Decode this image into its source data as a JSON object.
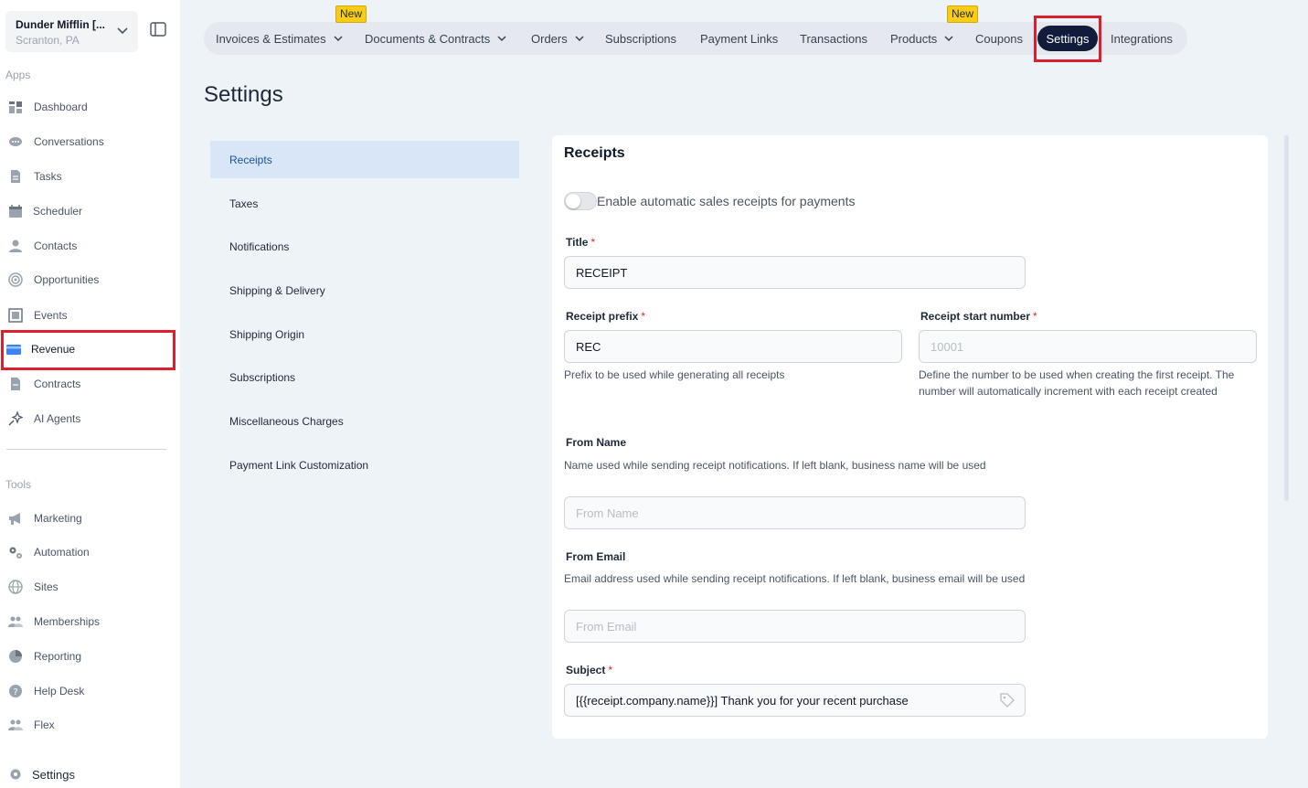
{
  "sidebar": {
    "location_name": "Dunder Mifflin [...",
    "location_sub": "Scranton, PA",
    "apps_label": "Apps",
    "tools_label": "Tools",
    "apps": [
      {
        "label": "Dashboard",
        "icon": "dashboard-icon"
      },
      {
        "label": "Conversations",
        "icon": "chat-icon"
      },
      {
        "label": "Tasks",
        "icon": "task-icon"
      },
      {
        "label": "Scheduler",
        "icon": "calendar-icon"
      },
      {
        "label": "Contacts",
        "icon": "user-icon"
      },
      {
        "label": "Opportunities",
        "icon": "target-icon"
      },
      {
        "label": "Events",
        "icon": "events-icon"
      },
      {
        "label": "Revenue",
        "icon": "card-icon"
      },
      {
        "label": "Contracts",
        "icon": "document-icon"
      },
      {
        "label": "AI Agents",
        "icon": "sparkle-icon"
      }
    ],
    "tools": [
      {
        "label": "Marketing",
        "icon": "megaphone-icon"
      },
      {
        "label": "Automation",
        "icon": "gears-icon"
      },
      {
        "label": "Sites",
        "icon": "globe-icon"
      },
      {
        "label": "Memberships",
        "icon": "people-icon"
      },
      {
        "label": "Reporting",
        "icon": "pie-icon"
      },
      {
        "label": "Help Desk",
        "icon": "help-icon"
      },
      {
        "label": "Flex",
        "icon": "people-icon"
      }
    ],
    "settings_label": "Settings"
  },
  "topnav": {
    "tabs": [
      {
        "label": "Invoices & Estimates",
        "dropdown": true
      },
      {
        "label": "Documents & Contracts",
        "dropdown": true
      },
      {
        "label": "Orders",
        "dropdown": true
      },
      {
        "label": "Subscriptions",
        "dropdown": false
      },
      {
        "label": "Payment Links",
        "dropdown": false
      },
      {
        "label": "Transactions",
        "dropdown": false
      },
      {
        "label": "Products",
        "dropdown": true
      },
      {
        "label": "Coupons",
        "dropdown": false
      },
      {
        "label": "Settings",
        "dropdown": false
      },
      {
        "label": "Integrations",
        "dropdown": false
      }
    ],
    "badge_new": "New"
  },
  "page_title": "Settings",
  "submenu": [
    "Receipts",
    "Taxes",
    "Notifications",
    "Shipping & Delivery",
    "Shipping Origin",
    "Subscriptions",
    "Miscellaneous Charges",
    "Payment Link Customization"
  ],
  "receipts": {
    "title": "Receipts",
    "toggle_label": "Enable automatic sales receipts for payments",
    "title_label": "Title",
    "title_value": "RECEIPT",
    "prefix_label": "Receipt prefix",
    "prefix_value": "REC",
    "prefix_help": "Prefix to be used while generating all receipts",
    "start_label": "Receipt start number",
    "start_placeholder": "10001",
    "start_help": "Define the number to be used when creating the first receipt. The number will automatically increment with each receipt created",
    "from_name_label": "From Name",
    "from_name_help": "Name used while sending receipt notifications. If left blank, business name will be used",
    "from_name_placeholder": "From Name",
    "from_email_label": "From Email",
    "from_email_help": "Email address used while sending receipt notifications. If left blank, business email will be used",
    "from_email_placeholder": "From Email",
    "subject_label": "Subject",
    "subject_value": "[{{receipt.company.name}}] Thank you for your recent purchase",
    "required_mark": "*"
  },
  "colors": {
    "accent": "#111c3a",
    "highlight": "#dc1f2e",
    "badge": "#facc15"
  }
}
